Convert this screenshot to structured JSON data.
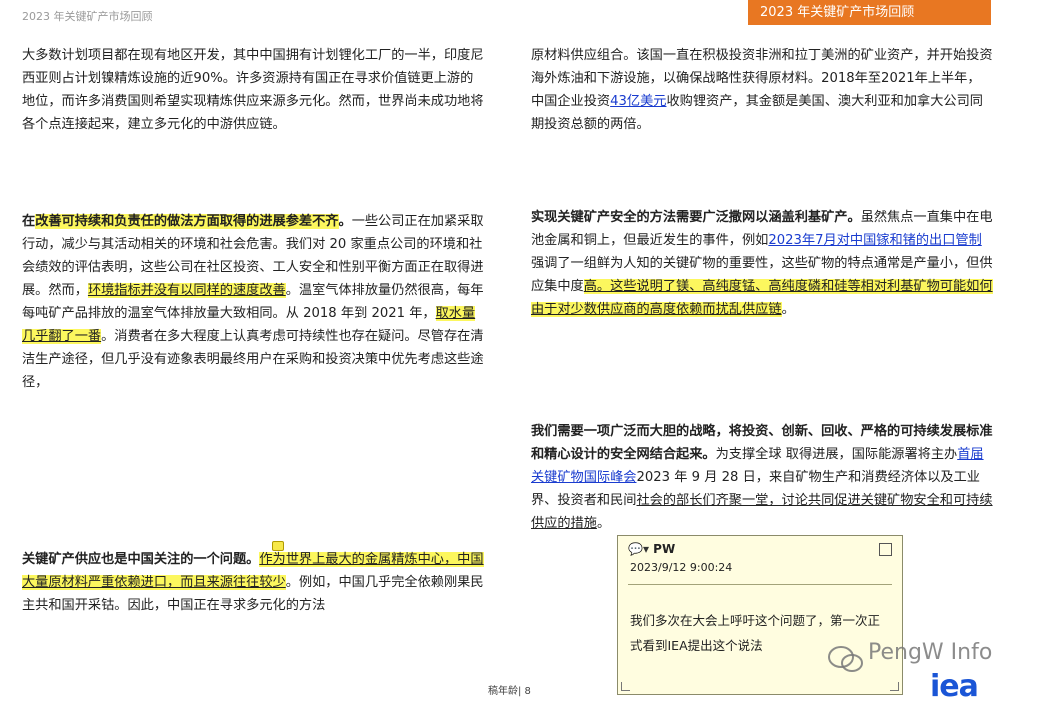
{
  "header": {
    "left_title": "2023 年关键矿产市场回顾",
    "right_title": "2023 年关键矿产市场回顾"
  },
  "col_left": {
    "p1": "大多数计划项目都在现有地区开发，其中中国拥有计划锂化工厂的一半，印度尼西亚则占计划镍精炼设施的近90%。许多资源持有国正在寻求价值链更上游的地位，而许多消费国则希望实现精炼供应来源多元化。然而，世界尚未成功地将各个点连接起来，建立多元化的中游供应链。",
    "p2_pre": "在",
    "p2_bold_hl": "改善可持续和负责任的做法方面取得的进展参差不齐",
    "p2_bold_end": "。",
    "p2_a": "一些公司正在加紧采取行动，减少与其活动相关的环境和社会危害。我们对 20 家重点公司的环境和社会绩效的评估表明，这些公司在社区投资、工人安全和性别平衡方面正在取得进展。然而，",
    "p2_hl1": "环境指标并没有以同样的速度改善",
    "p2_b": "。温室气体排放量仍然很高，每年每吨矿产品排放的温室气体排放量大致相同。从 2018 年到 2021 年，",
    "p2_hl2": "取水量几乎翻了一番",
    "p2_c": "。消费者在多大程度上认真考虑可持续性也存在疑问。尽管存在清洁生产途径，但几乎没有迹象表明最终用户在采购和投资决策中优先考虑这些途径，",
    "p3_bold": "关键矿产供应也是中国关注的一个问题。",
    "p3_hl": "作为世界上最大的金属精炼中心，中国大量原材料严重依赖进口，而且来源往往较少",
    "p3_rest": "。例如，中国几乎完全依赖刚果民主共和国开采钴。因此，中国正在寻求多元化的方法"
  },
  "col_right": {
    "p1_a": "原材料供应组合。该国一直在积极投资非洲和拉丁美洲的矿业资产，并开始投资海外炼油和下游设施，以确保战略性获得原材料。2018年至2021年上半年，中国企业投资",
    "p1_link": "43亿美元",
    "p1_b": "收购锂资产，其金额是美国、澳大利亚和加拿大公司同期投资总额的两倍。",
    "p2_bold": "实现关键矿产安全的方法需要广泛撒网以涵盖利基矿产。",
    "p2_a": "虽然焦点一直集中在电池金属和铜上，但最近发生的事件，例如",
    "p2_link": "2023年7月对中国镓和锗的出口管制",
    "p2_b": "强调了一组鲜为人知的关键矿物的重要性，这些矿物的特点通常是产量小，但供应集中度",
    "p2_hl": "高。这些说明了镁、高纯度锰、高纯度磷和硅等相对利基矿物可能如何由于对少数供应商的高度依赖而扰乱供应链",
    "p2_end": "。",
    "p3_bold": "我们需要一项广泛而大胆的战略，将投资、创新、回收、严格的可持续发展标准和精心设计的安全网结合起来。",
    "p3_a": "为支撑全球 取得进展，国际能源署将主办",
    "p3_link": "首届关键矿物国际峰会",
    "p3_b": "2023 年 9 月 28 日，来自矿物生产和消费经济体以及工业界、投资者和民间",
    "p3_ul": "社会的部长们齐聚一堂，讨论共同促进关键矿物安全和可持续供应的措施",
    "p3_end": "。"
  },
  "comment": {
    "author": "PW",
    "timestamp": "2023/9/12 9:00:24",
    "text": "我们多次在大会上呼吁这个问题了，第一次正式看到IEA提出这个说法"
  },
  "footer": {
    "page_label": "稿年龄| 8"
  },
  "watermark": {
    "text": "PengW Info"
  },
  "logo": {
    "text": "iea"
  },
  "colors": {
    "accent": "#e87722",
    "highlight": "#fcf75e",
    "link": "#1a3ccf",
    "logo": "#1a55d6"
  }
}
